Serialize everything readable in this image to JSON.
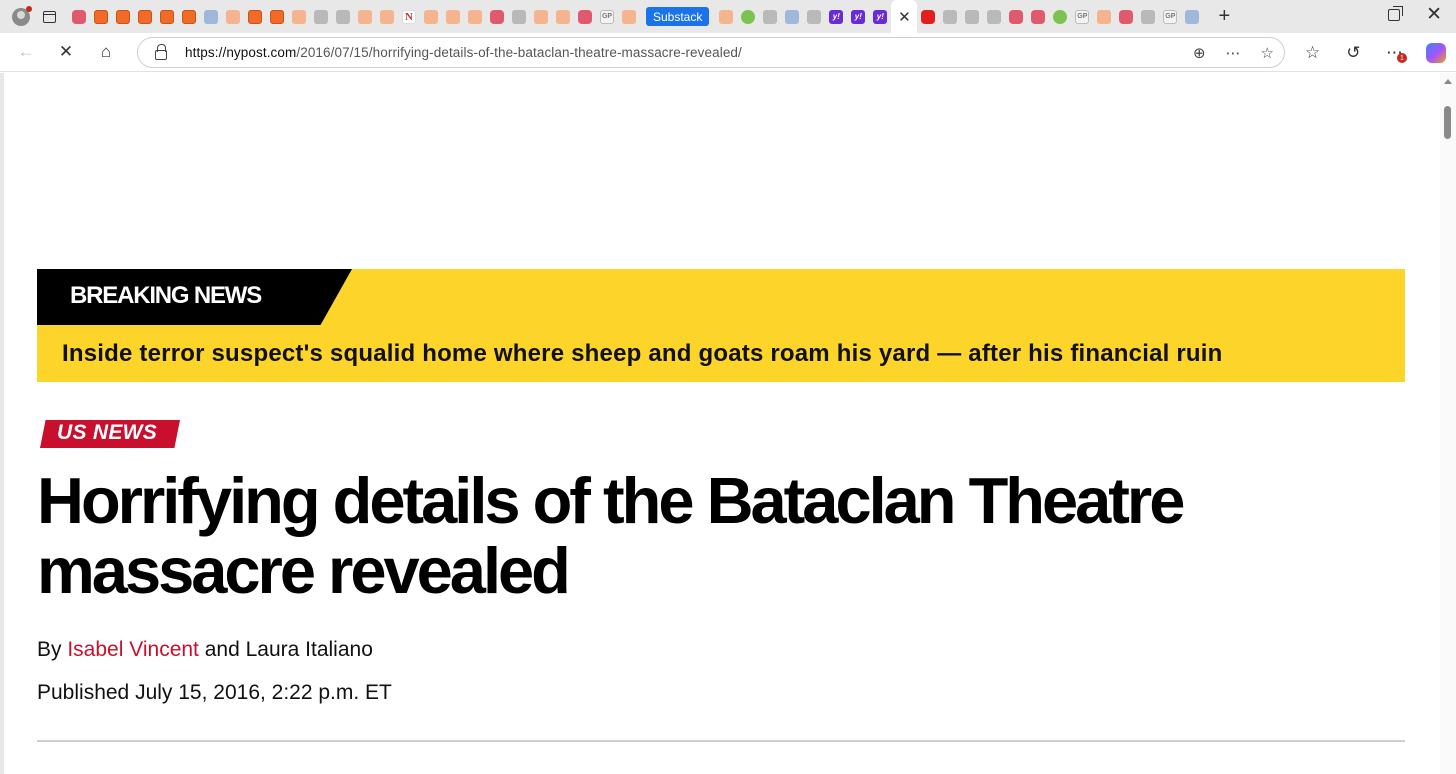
{
  "browser": {
    "tab_badge_label": "Substack",
    "url_host": "https://nypost.com",
    "url_path": "/2016/07/15/horrifying-details-of-the-bataclan-theatre-massacre-revealed/",
    "notification_count": "1"
  },
  "banner": {
    "tag": "BREAKING NEWS",
    "headline": "Inside terror suspect's squalid home where sheep and goats roam his yard — after his financial ruin"
  },
  "article": {
    "section": "US NEWS",
    "title": "Horrifying details of the Bataclan Theatre massacre revealed",
    "byline_prefix": "By ",
    "author_1": "Isabel Vincent",
    "byline_joiner": " and ",
    "author_2": "Laura Italiano",
    "published": "Published July 15, 2016, 2:22 p.m. ET"
  },
  "colors": {
    "banner_yellow": "#fcd42a",
    "section_red": "#c8102e",
    "link_red": "#c8102e"
  }
}
